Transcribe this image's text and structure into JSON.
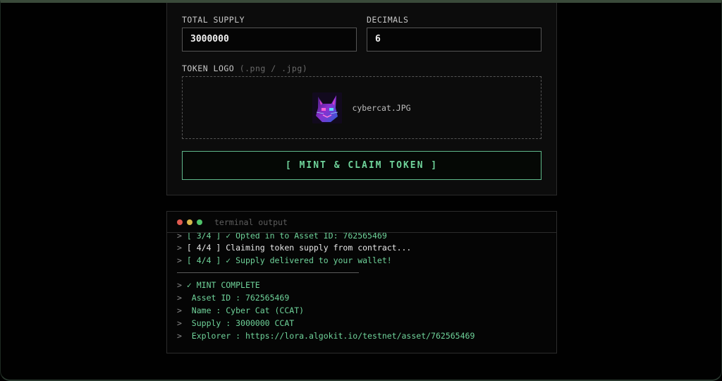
{
  "form": {
    "total_supply": {
      "label": "TOTAL SUPPLY",
      "value": "3000000"
    },
    "decimals": {
      "label": "DECIMALS",
      "value": "6"
    },
    "token_logo": {
      "label": "TOKEN LOGO",
      "hint": "(.png / .jpg)",
      "file_name": "cybercat.JPG",
      "thumbnail_icon": "cyber-cat-image"
    },
    "mint_button_label": "[ MINT & CLAIM TOKEN ]"
  },
  "terminal": {
    "title": "terminal output",
    "window_controls": [
      "close",
      "minimize",
      "maximize"
    ],
    "lines": [
      {
        "prompt": ">",
        "text": "[ 3/4 ] ✓ Opted in to Asset ID: 762565469",
        "color": "#6fd39a"
      },
      {
        "prompt": ">",
        "text": "[ 4/4 ] Claiming token supply from contract...",
        "color": "#e8e8e8"
      },
      {
        "prompt": ">",
        "text": "[ 4/4 ] ✓ Supply delivered to your wallet!",
        "color": "#6fd39a"
      }
    ],
    "result_lines": [
      {
        "prompt": ">",
        "text": "✓ MINT COMPLETE"
      },
      {
        "prompt": ">",
        "text": " Asset ID : 762565469"
      },
      {
        "prompt": ">",
        "text": " Name : Cyber Cat (CCAT)"
      },
      {
        "prompt": ">",
        "text": " Supply : 3000000 CCAT"
      },
      {
        "prompt": ">",
        "text": " Explorer : https://lora.algokit.io/testnet/asset/762565469"
      }
    ]
  },
  "colors": {
    "accent_green": "#6fd39a",
    "background": "#000000",
    "dot_red": "#e05a4f",
    "dot_yellow": "#d8b74a",
    "dot_green": "#4fc36a"
  }
}
